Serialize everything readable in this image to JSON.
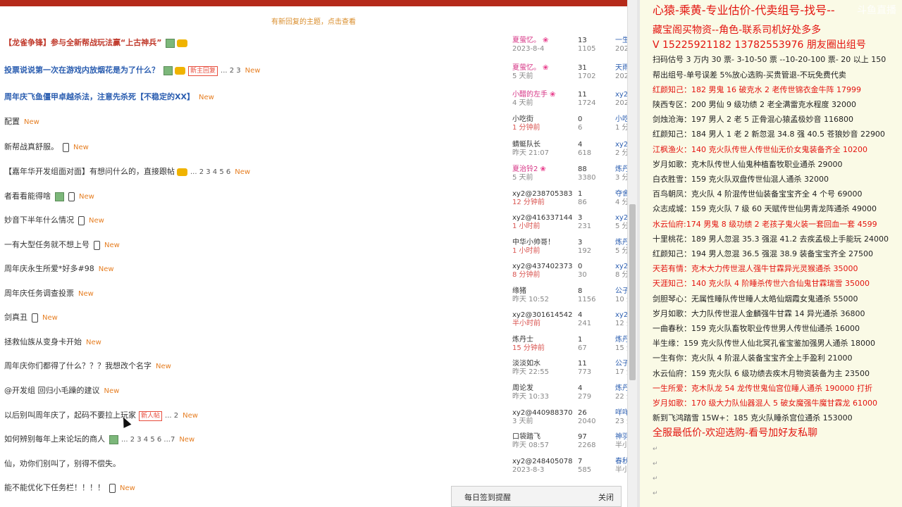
{
  "forum": {
    "notice": "有新回复的主题，点击查看",
    "threads": [
      {
        "title": "【龙雀争锋】参与全新帮战玩法赢“上古神兵”",
        "style": "red bold",
        "img": true,
        "gold": true,
        "phone": false,
        "badge": "",
        "pages": "",
        "new": "",
        "author": "夏萤忆。",
        "author_pink": true,
        "date": "2023-8-4",
        "date_red": false,
        "replies": "13",
        "views": "1105",
        "last_user": "一生",
        "last_date": "202"
      },
      {
        "title": "投票说说第一次在游戏内放烟花是为了什么？",
        "style": "blue bold",
        "img": true,
        "gold": true,
        "phone": false,
        "badge": "新主回复",
        "pages": "... 2  3",
        "new": "New",
        "author": "夏萤忆。",
        "author_pink": true,
        "date": "5 天前",
        "date_red": false,
        "replies": "31",
        "views": "1702",
        "last_user": "天雨",
        "last_date": "202"
      },
      {
        "title": "周年庆飞鱼僵甲卓越杀法，注意先杀死【不稳定的XX】",
        "style": "blue bold",
        "img": false,
        "gold": false,
        "phone": false,
        "badge": "",
        "pages": "",
        "new": "New",
        "author": "小醋的左手",
        "author_pink": true,
        "date": "4 天前",
        "date_red": false,
        "replies": "11",
        "views": "1724",
        "last_user": "xy2",
        "last_date": "202"
      },
      {
        "title": "配置",
        "style": "",
        "img": false,
        "gold": false,
        "phone": false,
        "badge": "",
        "pages": "",
        "new": "New",
        "author": "小吃街",
        "author_pink": false,
        "date": "1 分钟前",
        "date_red": true,
        "replies": "0",
        "views": "6",
        "last_user": "小吃",
        "last_date": "1 分"
      },
      {
        "title": "新帮战真舒服。",
        "style": "",
        "img": false,
        "gold": false,
        "phone": true,
        "badge": "",
        "pages": "",
        "new": "New",
        "author": "蜻蜓队长",
        "author_pink": false,
        "date": "昨天 21:07",
        "date_red": false,
        "replies": "4",
        "views": "618",
        "last_user": "xy2",
        "last_date": "2 分"
      },
      {
        "title": "【嘉年华开发组面对面】有想问什么的，直接跟帖",
        "style": "",
        "img": false,
        "gold": true,
        "phone": false,
        "badge": "",
        "pages": "... 2  3  4  5  6",
        "new": "New",
        "author": "夏治铃2",
        "author_pink": true,
        "date": "5 天前",
        "date_red": false,
        "replies": "88",
        "views": "3380",
        "last_user": "炼丹",
        "last_date": "3 分"
      },
      {
        "title": "者看看能得啥",
        "style": "",
        "img": true,
        "gold": false,
        "phone": true,
        "badge": "",
        "pages": "",
        "new": "New",
        "author": "xy2@238705383",
        "author_pink": false,
        "date": "12 分钟前",
        "date_red": true,
        "replies": "1",
        "views": "86",
        "last_user": "夺舍",
        "last_date": "4 分"
      },
      {
        "title": "妙音下半年什么情况",
        "style": "",
        "img": false,
        "gold": false,
        "phone": true,
        "badge": "",
        "pages": "",
        "new": "New",
        "author": "xy2@416337144",
        "author_pink": false,
        "date": "1 小时前",
        "date_red": true,
        "replies": "3",
        "views": "231",
        "last_user": "xy2",
        "last_date": "5 分"
      },
      {
        "title": "一有大型任务就不想上号",
        "style": "",
        "img": false,
        "gold": false,
        "phone": true,
        "badge": "",
        "pages": "",
        "new": "New",
        "author": "中华小帅哥！",
        "author_pink": false,
        "date": "1 小时前",
        "date_red": true,
        "replies": "3",
        "views": "192",
        "last_user": "炼丹",
        "last_date": "5 分"
      },
      {
        "title": "周年庆永生所爱*好多#98",
        "style": "",
        "img": false,
        "gold": false,
        "phone": false,
        "badge": "",
        "pages": "",
        "new": "New",
        "author": "xy2@437402373",
        "author_pink": false,
        "date": "8 分钟前",
        "date_red": true,
        "replies": "0",
        "views": "30",
        "last_user": "xy2",
        "last_date": "8 分"
      },
      {
        "title": "周年庆任务调查投票",
        "style": "",
        "img": false,
        "gold": false,
        "phone": false,
        "badge": "",
        "pages": "",
        "new": "New",
        "author": "缘猪",
        "author_pink": false,
        "date": "昨天 10:52",
        "date_red": false,
        "replies": "8",
        "views": "1156",
        "last_user": "公子",
        "last_date": "10 分"
      },
      {
        "title": "剑真丑",
        "style": "",
        "img": false,
        "gold": false,
        "phone": true,
        "badge": "",
        "pages": "",
        "new": "New",
        "author": "xy2@301614542",
        "author_pink": false,
        "date": "半小时前",
        "date_red": true,
        "replies": "4",
        "views": "241",
        "last_user": "xy2",
        "last_date": "12 分"
      },
      {
        "title": "拯救仙族从变身卡开始",
        "style": "",
        "img": false,
        "gold": false,
        "phone": false,
        "badge": "",
        "pages": "",
        "new": "New",
        "author": "炼丹士",
        "author_pink": false,
        "date": "15 分钟前",
        "date_red": true,
        "replies": "1",
        "views": "67",
        "last_user": "炼丹",
        "last_date": "15 分"
      },
      {
        "title": "周年庆你们都得了什么？？？我想改个名字",
        "style": "",
        "img": false,
        "gold": false,
        "phone": false,
        "badge": "",
        "pages": "",
        "new": "New",
        "author": "淡淡如水",
        "author_pink": false,
        "date": "昨天 22:55",
        "date_red": false,
        "replies": "11",
        "views": "773",
        "last_user": "公子",
        "last_date": "17 分"
      },
      {
        "title": "@开发组 回归小毛躁的建议",
        "style": "",
        "img": false,
        "gold": false,
        "phone": false,
        "badge": "",
        "pages": "",
        "new": "New",
        "author": "周论发",
        "author_pink": false,
        "date": "昨天 10:33",
        "date_red": false,
        "replies": "4",
        "views": "279",
        "last_user": "炼丹",
        "last_date": "22 分"
      },
      {
        "title": "以后别叫周年庆了，起码不要拉上玩家",
        "style": "",
        "img": false,
        "gold": false,
        "phone": false,
        "badge": "新人帖",
        "pages": "... 2",
        "new": "New",
        "author": "xy2@440988370",
        "author_pink": false,
        "date": "3 天前",
        "date_red": false,
        "replies": "26",
        "views": "2040",
        "last_user": "咩咩",
        "last_date": "23 分"
      },
      {
        "title": "如何辨别每年上来论坛的商人",
        "style": "",
        "img": true,
        "gold": false,
        "phone": false,
        "badge": "",
        "pages": "... 2  3  4  5  6 ...7",
        "new": "New",
        "author": "口袋踏飞",
        "author_pink": false,
        "date": "昨天 08:57",
        "date_red": false,
        "replies": "97",
        "views": "2268",
        "last_user": "神羽",
        "last_date": "半小"
      },
      {
        "title": "仙，劝你们别叫了，别得不偿失。",
        "style": "",
        "img": false,
        "gold": false,
        "phone": false,
        "badge": "",
        "pages": "",
        "new": "",
        "author": "xy2@248405078",
        "author_pink": false,
        "date": "2023-8-3",
        "date_red": false,
        "replies": "7",
        "views": "585",
        "last_user": "春秋",
        "last_date": "半小"
      },
      {
        "title": "能不能优化下任务栏！！！！",
        "style": "",
        "img": false,
        "gold": false,
        "phone": true,
        "badge": "",
        "pages": "",
        "new": "New",
        "author": "",
        "author_pink": false,
        "date": "",
        "date_red": false,
        "replies": "",
        "views": "",
        "last_user": "",
        "last_date": ""
      }
    ],
    "popup": {
      "title": "每日签到提醒",
      "close": "关闭"
    }
  },
  "ad": {
    "watermark": "斗鱼直播",
    "lines": [
      {
        "text": "心猿-乘黄-专业估价-代卖组号-找号--",
        "kind": "headline"
      },
      {
        "text": "藏宝阁买物资--角色-联系司机好处多多",
        "kind": "red big"
      },
      {
        "text": "V 15225921182   13782553976 朋友圈出组号",
        "kind": "red big"
      },
      {
        "text": "扫码估号 3 万内 30 票- 3-10-50 票  --10-20-100 票- 20 以上 150",
        "kind": ""
      },
      {
        "text": "帮出组号-单号误差 5%放心选购-买贵管退-不玩免费代卖",
        "kind": ""
      },
      {
        "text": "红颜知己：182 男鬼 16 破克水 2 老传世锦衣金牛阵 17999",
        "kind": "red"
      },
      {
        "text": "陕西专区：200 男仙 9 级功绩 2 老全满雷克水程度 32000",
        "kind": ""
      },
      {
        "text": "剑烛沧海：197 男人 2 老 5 正骨混心猿孟极妙音 116800",
        "kind": ""
      },
      {
        "text": "红颜知己：184 男人 1 老 2 新忽混 34.8 强 40.5 苍狼妙音 22900",
        "kind": ""
      },
      {
        "text": "江枫渔火：140 克火队传世人传世仙无价女鬼装备齐全 10200",
        "kind": "red"
      },
      {
        "text": "岁月如歌：克木队传世人仙鬼种植畜牧职业通杀 29000",
        "kind": ""
      },
      {
        "text": "白衣胜雪：159 克火队双盘传世仙混人通杀 32000",
        "kind": ""
      },
      {
        "text": "百鸟朝凤：克火队 4 阶混传世仙装备宝宝齐全 4 个号 69000",
        "kind": ""
      },
      {
        "text": "众志成城：159 克火队 7 级 60 天赋传世仙男青龙阵通杀 49000",
        "kind": ""
      },
      {
        "text": "水云仙府:174 男鬼 8 级功绩 2 老孩子鬼火装一套回血一套 4599",
        "kind": "red"
      },
      {
        "text": "十里桃花：189 男人忽混 35.3 强混 41.2 去疾孟极上手能玩 24000",
        "kind": ""
      },
      {
        "text": "红颜知己：194 男人忽混 36.5 强混 38.9 装备宝宝齐全 27500",
        "kind": ""
      },
      {
        "text": "天若有情：克木大力传世混人强牛甘霖异光灵猴通杀 35000",
        "kind": "red"
      },
      {
        "text": "天涯知己：140 克火队 4 阶睡杀传世六合仙鬼甘霖瑞雪 35000",
        "kind": "red"
      },
      {
        "text": "剑胆琴心：无属性睡队传世睡人太皓仙烟霞女鬼通杀 55000",
        "kind": ""
      },
      {
        "text": "岁月如歌：大力队传世混人金麟强牛甘霖 14 异光通杀 36800",
        "kind": ""
      },
      {
        "text": "一曲春秋：159 克火队畜牧职业传世男人传世仙通杀 16000",
        "kind": ""
      },
      {
        "text": "半生缘：159 克火队传世人仙北冥孔雀宝鉴加强男人通杀 18000",
        "kind": ""
      },
      {
        "text": "一生有你：克火队 4 阶混人装备宝宝齐全上手盈利 21000",
        "kind": ""
      },
      {
        "text": "水云仙府：159 克火队 6 级功绩去疾木月物资装备为主 23500",
        "kind": ""
      },
      {
        "text": "一生所爱：克木队龙 54 龙传世鬼仙宫位睡人通杀 190000 打折",
        "kind": "red"
      },
      {
        "text": "岁月如歌：170 级大力队仙器混人 5 破女魔强牛魔甘霖龙 61000",
        "kind": "red"
      },
      {
        "text": "新到飞鸿踏雪 15W+：185 克火队睡杀宫位通杀 153000",
        "kind": ""
      },
      {
        "text": "全服最低价-欢迎选购-看号加好友私聊",
        "kind": "red big"
      }
    ]
  }
}
